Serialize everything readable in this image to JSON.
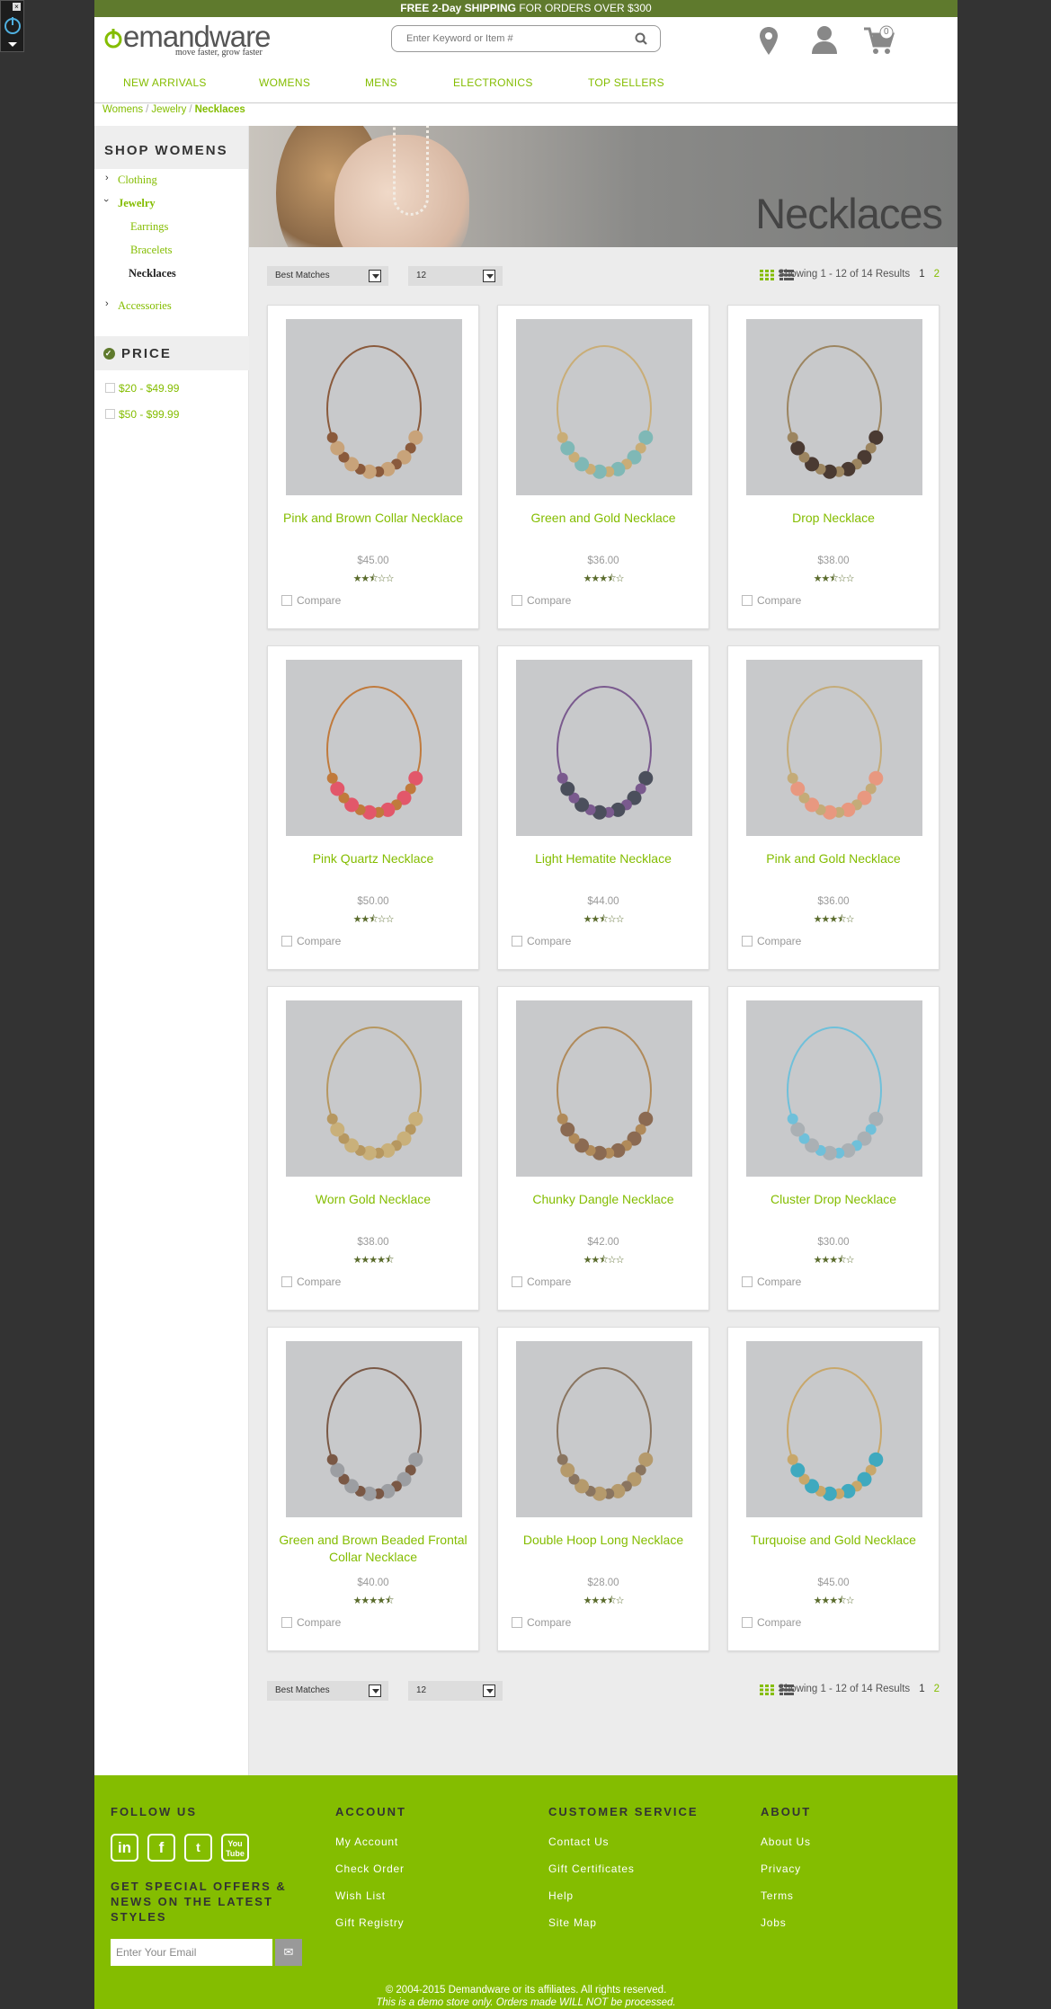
{
  "promo": {
    "bold": "FREE 2-Day SHIPPING",
    "rest": " FOR ORDERS OVER $300"
  },
  "brand": {
    "name_accent": "d",
    "name_rest": "emandware",
    "tagline": "move faster, grow faster",
    "color": "#84bd00"
  },
  "search": {
    "placeholder": "Enter Keyword or Item #"
  },
  "cart": {
    "count": "0"
  },
  "nav": [
    "NEW ARRIVALS",
    "WOMENS",
    "MENS",
    "ELECTRONICS",
    "TOP SELLERS"
  ],
  "breadcrumb": {
    "items": [
      "Womens",
      "Jewelry"
    ],
    "current": "Necklaces",
    "sep": "/"
  },
  "sidebar": {
    "title": "SHOP WOMENS",
    "categories": [
      "Clothing",
      "Jewelry",
      "Accessories"
    ],
    "subcategories": [
      "Earrings",
      "Bracelets",
      "Necklaces"
    ],
    "price_title": "PRICE",
    "price_filters": [
      "$20 - $49.99",
      "$50 - $99.99"
    ]
  },
  "banner": {
    "title": "Necklaces"
  },
  "toolbar": {
    "sort": "Best Matches",
    "per_page": "12",
    "showing": "Showing 1 - 12 of 14 Results",
    "page1": "1",
    "page2": "2"
  },
  "compare_label": "Compare",
  "products": [
    {
      "name": "Pink and Brown Collar Necklace",
      "price": "$45.00",
      "rating": 2.5
    },
    {
      "name": "Green and Gold Necklace",
      "price": "$36.00",
      "rating": 3.5
    },
    {
      "name": "Drop Necklace",
      "price": "$38.00",
      "rating": 2.5
    },
    {
      "name": "Pink Quartz Necklace",
      "price": "$50.00",
      "rating": 2.5
    },
    {
      "name": "Light Hematite Necklace",
      "price": "$44.00",
      "rating": 2.5
    },
    {
      "name": "Pink and Gold Necklace",
      "price": "$36.00",
      "rating": 3.5
    },
    {
      "name": "Worn Gold Necklace",
      "price": "$38.00",
      "rating": 4.5
    },
    {
      "name": "Chunky Dangle Necklace",
      "price": "$42.00",
      "rating": 2.5
    },
    {
      "name": "Cluster Drop Necklace",
      "price": "$30.00",
      "rating": 3.5
    },
    {
      "name": "Green and Brown Beaded Frontal Collar Necklace",
      "price": "$40.00",
      "rating": 4.5
    },
    {
      "name": "Double Hoop Long Necklace",
      "price": "$28.00",
      "rating": 3.5
    },
    {
      "name": "Turquoise and Gold Necklace",
      "price": "$45.00",
      "rating": 3.5
    }
  ],
  "footer": {
    "follow": "FOLLOW US",
    "social": [
      "linkedin-icon",
      "facebook-icon",
      "twitter-icon",
      "youtube-icon"
    ],
    "offers": "GET SPECIAL OFFERS & NEWS ON THE LATEST STYLES",
    "email_placeholder": "Enter Your Email",
    "columns": [
      {
        "title": "ACCOUNT",
        "links": [
          "My Account",
          "Check Order",
          "Wish List",
          "Gift Registry"
        ]
      },
      {
        "title": "CUSTOMER SERVICE",
        "links": [
          "Contact Us",
          "Gift Certificates",
          "Help",
          "Site Map"
        ]
      },
      {
        "title": "ABOUT",
        "links": [
          "About Us",
          "Privacy",
          "Terms",
          "Jobs"
        ]
      }
    ],
    "copyright": "© 2004-2015 Demandware or its affiliates. All rights reserved.",
    "demo": "This is a demo store only. Orders made WILL NOT be processed."
  }
}
